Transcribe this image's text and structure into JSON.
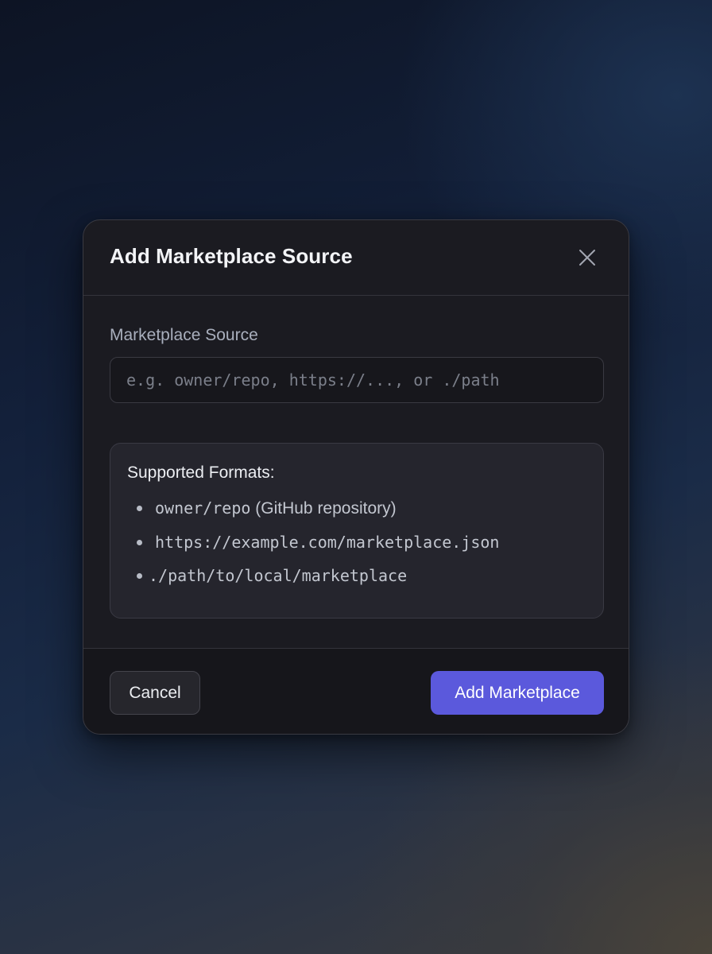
{
  "dialog": {
    "title": "Add Marketplace Source",
    "close_icon": "close-icon"
  },
  "source_field": {
    "label": "Marketplace Source",
    "value": "",
    "placeholder": "e.g. owner/repo, https://..., or ./path"
  },
  "formats": {
    "heading": "Supported Formats:",
    "items": [
      {
        "code": "owner/repo",
        "description": " (GitHub repository)"
      },
      {
        "code": "https://example.com/marketplace.json",
        "description": ""
      },
      {
        "code": "./path/to/local/marketplace",
        "description": ""
      }
    ]
  },
  "footer": {
    "cancel_label": "Cancel",
    "add_label": "Add Marketplace"
  },
  "colors": {
    "accent": "#5b59dc",
    "dialog_bg": "#1b1b21",
    "formats_bg": "#25252d"
  }
}
